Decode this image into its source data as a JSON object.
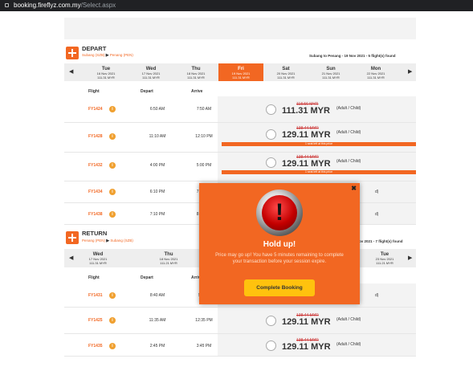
{
  "browser": {
    "domain": "booking.fireflyz.com.my",
    "path": "/Select.aspx"
  },
  "depart": {
    "title": "DEPART",
    "origin": "Subang (SZB)",
    "destination": "Penang (PEN)",
    "summary": "Subang to Penang - 19 Nov 2021 - 5 flight(s) found",
    "dates": [
      {
        "day": "Tue",
        "date": "16 Nov 2021",
        "price": "111.31 MYR"
      },
      {
        "day": "Wed",
        "date": "17 Nov 2021",
        "price": "111.31 MYR"
      },
      {
        "day": "Thu",
        "date": "18 Nov 2021",
        "price": "111.31 MYR"
      },
      {
        "day": "Fri",
        "date": "19 Nov 2021",
        "price": "111.31 MYR"
      },
      {
        "day": "Sat",
        "date": "20 Nov 2021",
        "price": "111.31 MYR"
      },
      {
        "day": "Sun",
        "date": "21 Nov 2021",
        "price": "111.31 MYR"
      },
      {
        "day": "Mon",
        "date": "22 Nov 2021",
        "price": "111.31 MYR"
      }
    ],
    "columns": {
      "flight": "Flight",
      "depart": "Depart",
      "arrive": "Arrive"
    },
    "flights": [
      {
        "no": "FY1424",
        "dep": "6:50 AM",
        "arr": "7:50 AM",
        "old": "118.56 MYR",
        "price": "111.31 MYR",
        "note": "(Adult / Child)"
      },
      {
        "no": "FY1428",
        "dep": "11:10 AM",
        "arr": "12:10 PM",
        "old": "138.44 MYR",
        "price": "129.11 MYR",
        "note": "(Adult / Child)",
        "seat": "1 seat left at this price"
      },
      {
        "no": "FY1432",
        "dep": "4:00 PM",
        "arr": "5:00 PM",
        "old": "138.44 MYR",
        "price": "129.11 MYR",
        "note": "(Adult / Child)",
        "seat": "1 seat left at this price"
      },
      {
        "no": "FY1434",
        "dep": "6:10 PM",
        "arr": "7:10 PM",
        "note": "d)"
      },
      {
        "no": "FY1438",
        "dep": "7:10 PM",
        "arr": "8:10 PM",
        "note": "d)"
      }
    ]
  },
  "return": {
    "title": "RETURN",
    "origin": "Penang (PEN)",
    "destination": "Subang (SZB)",
    "summary": "ov 2021 - 7 flight(s) found",
    "dates": [
      {
        "day": "Wed",
        "date": "17 Nov 2021",
        "price": "111.31 MYR"
      },
      {
        "day": "Thu",
        "date": "18 Nov 2021",
        "price": "111.21 MYR"
      },
      {
        "day": "Fri",
        "date": "19 Nov 2",
        "price": "111.21 M"
      },
      {
        "day": "Tue",
        "date": "23 Nov 2021",
        "price": "111.21 MYR"
      }
    ],
    "columns": {
      "flight": "Flight",
      "depart": "Depart",
      "arrive": "Arriv"
    },
    "flights": [
      {
        "no": "FY1431",
        "dep": "8:40 AM",
        "arr": "9:40 A",
        "note": "d)"
      },
      {
        "no": "FY1425",
        "dep": "11:35 AM",
        "arr": "12:35 PM",
        "old": "138.44 MYR",
        "price": "129.11 MYR",
        "note": "(Adult / Child)"
      },
      {
        "no": "FY1435",
        "dep": "2:45 PM",
        "arr": "3:45 PM",
        "old": "138.44 MYR",
        "price": "129.11 MYR",
        "note": "(Adult / Child)"
      }
    ]
  },
  "modal": {
    "close": "✖",
    "icon": "alarm-icon",
    "title": "Hold up!",
    "message": "Price may go up! You have 5 minutes remaining to complete your transaction before your session expire.",
    "button": "Complete Booking"
  },
  "colors": {
    "accent": "#f26722",
    "button": "#ffc20e"
  }
}
